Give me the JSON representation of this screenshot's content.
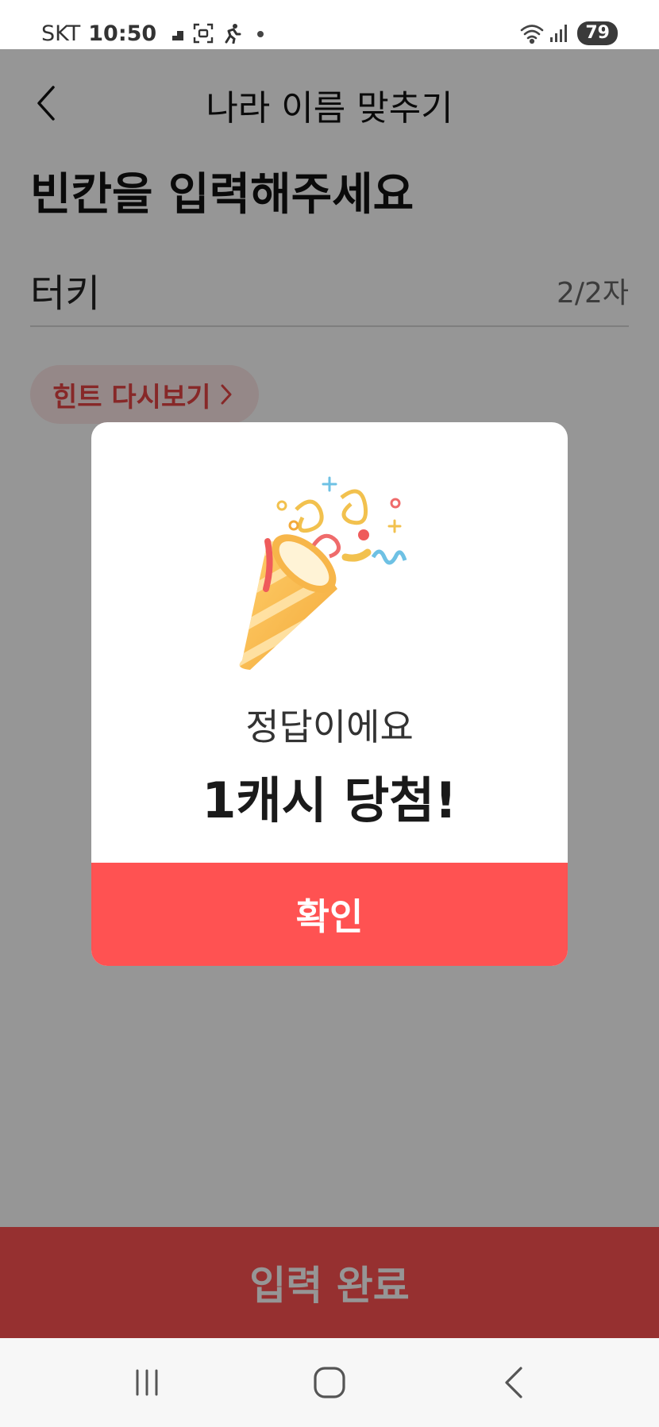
{
  "status_bar": {
    "carrier": "SKT",
    "time": "10:50",
    "battery": "79",
    "icons": [
      "step-count-icon",
      "screenshot-icon",
      "runner-icon",
      "notification-dot-icon",
      "wifi-icon",
      "signal-icon",
      "battery-icon"
    ]
  },
  "header": {
    "title": "나라 이름 맞추기",
    "back_icon": "chevron-left-icon"
  },
  "main": {
    "prompt": "빈칸을 입력해주세요",
    "input_value": "터키",
    "char_count": "2/2자",
    "hint_button": "힌트 다시보기",
    "hint_icon": "chevron-right-icon"
  },
  "footer": {
    "complete_button": "입력 완료"
  },
  "modal": {
    "illustration": "party-popper-icon",
    "subtitle": "정답이에요",
    "title": "1캐시 당첨!",
    "confirm_button": "확인"
  },
  "nav": {
    "items": [
      "recent-apps-icon",
      "home-icon",
      "back-icon"
    ]
  },
  "colors": {
    "accent": "#ff5252",
    "hint_bg": "#fde8e8",
    "overlay": "rgba(0,0,0,0.41)"
  }
}
